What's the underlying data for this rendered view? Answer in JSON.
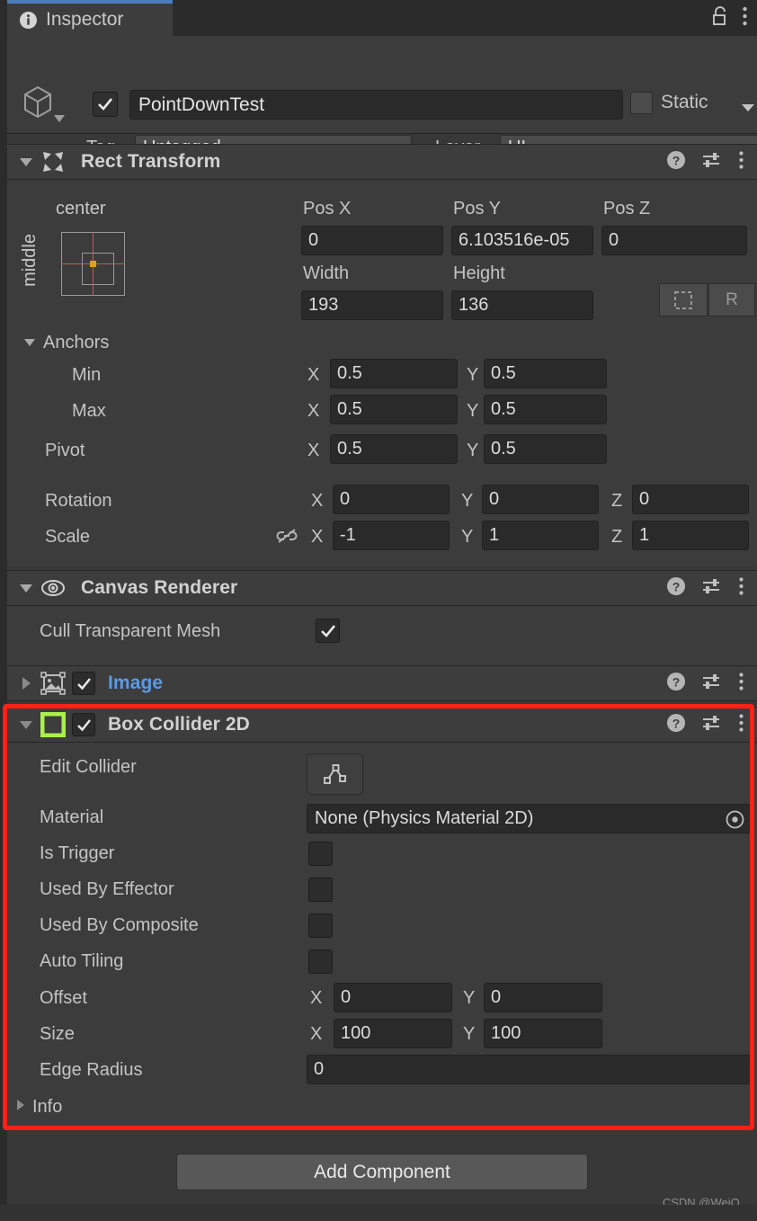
{
  "window": {
    "tab_label": "Inspector",
    "info_icon": "info-icon",
    "lock_icon": "lock-open-icon",
    "menu_icon": "kebab-menu-icon"
  },
  "game_object": {
    "icon": "cube-icon",
    "enabled": true,
    "name": "PointDownTest",
    "static_label": "Static",
    "static_checked": false,
    "tag_label": "Tag",
    "tag_value": "Untagged",
    "layer_label": "Layer",
    "layer_value": "UI"
  },
  "components": [
    {
      "title": "Rect Transform",
      "icon": "rect-transform-icon",
      "expanded": true,
      "help_icon": "help-icon",
      "preset_icon": "preset-icon",
      "menu_icon": "kebab-menu-icon"
    },
    {
      "title": "Canvas Renderer",
      "icon": "eye-icon",
      "expanded": true,
      "help_icon": "help-icon",
      "preset_icon": "preset-icon",
      "menu_icon": "kebab-menu-icon"
    },
    {
      "title": "Image",
      "icon": "image-icon",
      "expanded": false,
      "enabled": true,
      "help_icon": "help-icon",
      "preset_icon": "preset-icon",
      "menu_icon": "kebab-menu-icon"
    },
    {
      "title": "Box Collider 2D",
      "icon": "box-collider-2d-icon",
      "expanded": true,
      "enabled": true,
      "help_icon": "help-icon",
      "preset_icon": "preset-icon",
      "menu_icon": "kebab-menu-icon"
    }
  ],
  "rect_transform": {
    "anchor_preset": {
      "horizontal": "center",
      "vertical": "middle"
    },
    "pos_x_label": "Pos X",
    "pos_y_label": "Pos Y",
    "pos_z_label": "Pos Z",
    "pos_x": "0",
    "pos_y": "6.103516e-05",
    "pos_z": "0",
    "width_label": "Width",
    "height_label": "Height",
    "width": "193",
    "height": "136",
    "blueprint_icon": "blueprint-mode-icon",
    "raw_label": "R",
    "anchors_label": "Anchors",
    "min_label": "Min",
    "max_label": "Max",
    "pivot_label": "Pivot",
    "rotation_label": "Rotation",
    "scale_label": "Scale",
    "axis_x": "X",
    "axis_y": "Y",
    "axis_z": "Z",
    "min_x": "0.5",
    "min_y": "0.5",
    "max_x": "0.5",
    "max_y": "0.5",
    "pivot_x": "0.5",
    "pivot_y": "0.5",
    "rot_x": "0",
    "rot_y": "0",
    "rot_z": "0",
    "scale_x": "-1",
    "scale_y": "1",
    "scale_z": "1",
    "scale_link_icon": "link-off-icon"
  },
  "canvas_renderer": {
    "cull_label": "Cull Transparent Mesh",
    "cull_checked": true
  },
  "box_collider_2d": {
    "edit_collider_label": "Edit Collider",
    "edit_collider_icon": "edit-collider-icon",
    "material_label": "Material",
    "material_value": "None (Physics Material 2D)",
    "material_picker_icon": "object-picker-icon",
    "is_trigger_label": "Is Trigger",
    "is_trigger_checked": false,
    "used_by_effector_label": "Used By Effector",
    "used_by_effector_checked": false,
    "used_by_composite_label": "Used By Composite",
    "used_by_composite_checked": false,
    "auto_tiling_label": "Auto Tiling",
    "auto_tiling_checked": false,
    "offset_label": "Offset",
    "offset_x": "0",
    "offset_y": "0",
    "size_label": "Size",
    "size_x": "100",
    "size_y": "100",
    "edge_radius_label": "Edge Radius",
    "edge_radius": "0",
    "info_label": "Info",
    "axis_x": "X",
    "axis_y": "Y"
  },
  "footer": {
    "add_component_label": "Add Component",
    "watermark": "CSDN @WeiQ_"
  },
  "colors": {
    "highlight_border": "#ff2116",
    "accent_tab": "#4a7ebb",
    "component_link_blue": "#5b9ae6",
    "collider_icon_green": "#aaf04b",
    "pivot_orange": "#e0a01e",
    "anchor_red": "#c35a52"
  }
}
